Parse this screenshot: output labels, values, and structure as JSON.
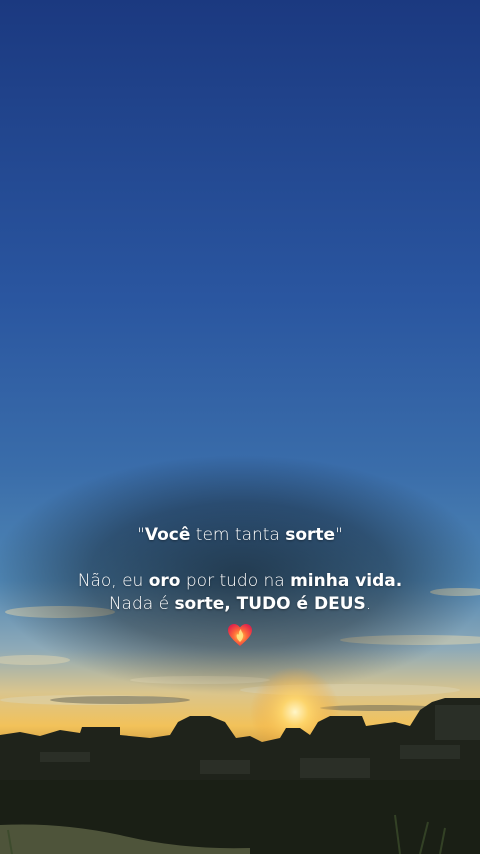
{
  "caption": {
    "quote": {
      "open": "\"",
      "bold1": "Você",
      "mid": " tem tanta ",
      "bold2": "sorte",
      "close": "\""
    },
    "line1": {
      "t1": "Não, eu ",
      "b1": "oro",
      "t2": " por tudo na ",
      "b2": "minha vida."
    },
    "line2": {
      "t1": "Nada é ",
      "b1": "sorte, TUDO é DEUS",
      "t2": "."
    },
    "emoji": "heart-on-fire"
  },
  "colors": {
    "sky_top": "#1c3b84",
    "sky_mid": "#3667a6",
    "horizon": "#f0c05a",
    "ground": "#1c2118"
  }
}
